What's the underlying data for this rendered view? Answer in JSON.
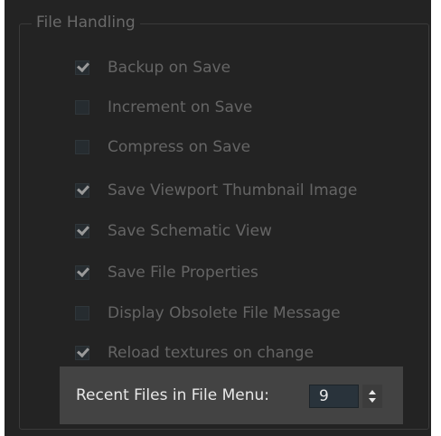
{
  "group": {
    "title": "File Handling"
  },
  "options": [
    {
      "label": "Backup on Save",
      "checked": true
    },
    {
      "label": "Increment on Save",
      "checked": false
    },
    {
      "label": "Compress on Save",
      "checked": false
    },
    {
      "label": "Save Viewport Thumbnail Image",
      "checked": true
    },
    {
      "label": "Save Schematic View",
      "checked": true
    },
    {
      "label": "Save File Properties",
      "checked": true
    },
    {
      "label": "Display Obsolete File Message",
      "checked": false
    },
    {
      "label": "Reload textures on change",
      "checked": true
    }
  ],
  "recent_files": {
    "label": "Recent Files in File Menu:",
    "value": "9"
  },
  "colors": {
    "panel_background": "#232323",
    "label_text": "#656565",
    "highlight_box": "#434343",
    "highlight_text": "#e8e8e8",
    "field_background": "#29333b"
  }
}
